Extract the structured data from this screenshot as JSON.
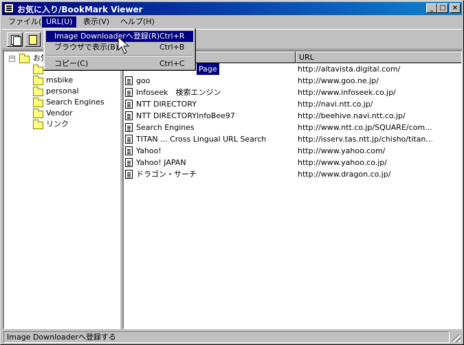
{
  "window": {
    "title": "お気に入り/BookMark Viewer"
  },
  "menubar": {
    "items": [
      "ファイル(F)",
      "URL(U)",
      "表示(V)",
      "ヘルプ(H)"
    ]
  },
  "url_menu": {
    "items": [
      {
        "label": "Image Downloaderへ登録(R)",
        "shortcut": "Ctrl+R"
      },
      {
        "label": "ブラウザで表示(B)",
        "shortcut": "Ctrl+B"
      },
      {
        "label": "コピー(C)",
        "shortcut": "Ctrl+C"
      }
    ]
  },
  "tree": {
    "root_label": "お気",
    "items": [
      "msbike",
      "personal",
      "Search Engines",
      "Vendor",
      "リンク"
    ]
  },
  "list": {
    "columns": [
      "",
      "URL"
    ],
    "rows": [
      {
        "title": "Page",
        "url": "http://altavista.digital.com/"
      },
      {
        "title": "goo",
        "url": "http://www.goo.ne.jp/"
      },
      {
        "title": "Infoseek　検索エンジン",
        "url": "http://www.infoseek.co.jp/"
      },
      {
        "title": "NTT DIRECTORY",
        "url": "http://navi.ntt.co.jp/"
      },
      {
        "title": "NTT DIRECTORYInfoBee97",
        "url": "http://beehive.navi.ntt.co.jp/"
      },
      {
        "title": "Search Engines",
        "url": "http://www.ntt.co.jp/SQUARE/com..."
      },
      {
        "title": "TITAN ... Cross Lingual URL Search",
        "url": "http://isserv.tas.ntt.jp/chisho/titan..."
      },
      {
        "title": "Yahoo!",
        "url": "http://www.yahoo.com/"
      },
      {
        "title": "Yahoo! JAPAN",
        "url": "http://www.yahoo.co.jp/"
      },
      {
        "title": "ドラゴン・サーチ",
        "url": "http://www.dragon.co.jp/"
      }
    ]
  },
  "statusbar": {
    "text": "Image Downloaderへ登録する"
  }
}
